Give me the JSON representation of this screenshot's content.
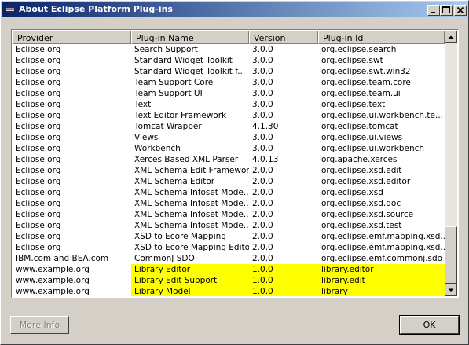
{
  "window": {
    "title": "About Eclipse Platform Plug-ins",
    "icon": "eclipse-icon",
    "controls": [
      "minimize-icon",
      "maximize-icon",
      "close-icon"
    ]
  },
  "table": {
    "columns": [
      "Provider",
      "Plug-in Name",
      "Version",
      "Plug-in Id"
    ],
    "rows": [
      {
        "provider": "Eclipse.org",
        "name": "Search Support",
        "version": "3.0.0",
        "id": "org.eclipse.search",
        "highlight": false
      },
      {
        "provider": "Eclipse.org",
        "name": "Standard Widget Toolkit",
        "version": "3.0.0",
        "id": "org.eclipse.swt",
        "highlight": false
      },
      {
        "provider": "Eclipse.org",
        "name": "Standard Widget Toolkit f...",
        "version": "3.0.0",
        "id": "org.eclipse.swt.win32",
        "highlight": false
      },
      {
        "provider": "Eclipse.org",
        "name": "Team Support Core",
        "version": "3.0.0",
        "id": "org.eclipse.team.core",
        "highlight": false
      },
      {
        "provider": "Eclipse.org",
        "name": "Team Support UI",
        "version": "3.0.0",
        "id": "org.eclipse.team.ui",
        "highlight": false
      },
      {
        "provider": "Eclipse.org",
        "name": "Text",
        "version": "3.0.0",
        "id": "org.eclipse.text",
        "highlight": false
      },
      {
        "provider": "Eclipse.org",
        "name": "Text Editor Framework",
        "version": "3.0.0",
        "id": "org.eclipse.ui.workbench.te...",
        "highlight": false
      },
      {
        "provider": "Eclipse.org",
        "name": "Tomcat Wrapper",
        "version": "4.1.30",
        "id": "org.eclipse.tomcat",
        "highlight": false
      },
      {
        "provider": "Eclipse.org",
        "name": "Views",
        "version": "3.0.0",
        "id": "org.eclipse.ui.views",
        "highlight": false
      },
      {
        "provider": "Eclipse.org",
        "name": "Workbench",
        "version": "3.0.0",
        "id": "org.eclipse.ui.workbench",
        "highlight": false
      },
      {
        "provider": "Eclipse.org",
        "name": "Xerces Based XML Parser",
        "version": "4.0.13",
        "id": "org.apache.xerces",
        "highlight": false
      },
      {
        "provider": "Eclipse.org",
        "name": "XML Schema Edit Framework",
        "version": "2.0.0",
        "id": "org.eclipse.xsd.edit",
        "highlight": false
      },
      {
        "provider": "Eclipse.org",
        "name": "XML Schema Editor",
        "version": "2.0.0",
        "id": "org.eclipse.xsd.editor",
        "highlight": false
      },
      {
        "provider": "Eclipse.org",
        "name": "XML Schema Infoset Mode...",
        "version": "2.0.0",
        "id": "org.eclipse.xsd",
        "highlight": false
      },
      {
        "provider": "Eclipse.org",
        "name": "XML Schema Infoset Mode...",
        "version": "2.0.0",
        "id": "org.eclipse.xsd.doc",
        "highlight": false
      },
      {
        "provider": "Eclipse.org",
        "name": "XML Schema Infoset Mode...",
        "version": "2.0.0",
        "id": "org.eclipse.xsd.source",
        "highlight": false
      },
      {
        "provider": "Eclipse.org",
        "name": "XML Schema Infoset Mode...",
        "version": "2.0.0",
        "id": "org.eclipse.xsd.test",
        "highlight": false
      },
      {
        "provider": "Eclipse.org",
        "name": "XSD to Ecore Mapping",
        "version": "2.0.0",
        "id": "org.eclipse.emf.mapping.xsd...",
        "highlight": false
      },
      {
        "provider": "Eclipse.org",
        "name": "XSD to Ecore Mapping Editor",
        "version": "2.0.0",
        "id": "org.eclipse.emf.mapping.xsd...",
        "highlight": false
      },
      {
        "provider": "IBM.com and BEA.com",
        "name": "CommonJ SDO",
        "version": "2.0.0",
        "id": "org.eclipse.emf.commonj.sdo",
        "highlight": false
      },
      {
        "provider": "www.example.org",
        "name": "Library Editor",
        "version": "1.0.0",
        "id": "library.editor",
        "highlight": true
      },
      {
        "provider": "www.example.org",
        "name": "Library Edit Support",
        "version": "1.0.0",
        "id": "library.edit",
        "highlight": true
      },
      {
        "provider": "www.example.org",
        "name": "Library Model",
        "version": "1.0.0",
        "id": "library",
        "highlight": true
      }
    ],
    "highlight_color": "#ffff00",
    "scroll_position": 1.0
  },
  "buttons": {
    "more_info": "More Info",
    "ok": "OK"
  }
}
